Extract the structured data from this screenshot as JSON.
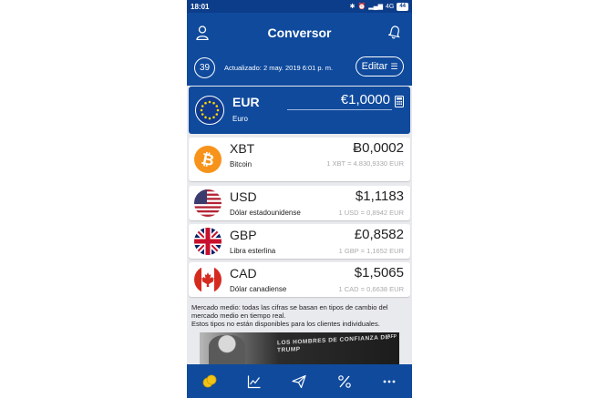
{
  "status_bar": {
    "time": "18:01",
    "network": "4G",
    "battery": "44"
  },
  "header": {
    "title": "Conversor",
    "timer": "39",
    "updated": "Actualizado: 2 may. 2019 6:01 p. m.",
    "edit_label": "Editar"
  },
  "base": {
    "code": "EUR",
    "name": "Euro",
    "amount": "€1,0000"
  },
  "currencies": [
    {
      "code": "XBT",
      "name": "Bitcoin",
      "amount": "Ƀ0,0002",
      "rate": "1 XBT = 4.830,9330 EUR"
    },
    {
      "code": "USD",
      "name": "Dólar estadounidense",
      "amount": "$1,1183",
      "rate": "1 USD = 0,8942 EUR"
    },
    {
      "code": "GBP",
      "name": "Libra esterlina",
      "amount": "£0,8582",
      "rate": "1 GBP = 1,1652 EUR"
    },
    {
      "code": "CAD",
      "name": "Dólar canadiense",
      "amount": "$1,5065",
      "rate": "1 CAD = 0,6638 EUR"
    }
  ],
  "note": {
    "line1": "Mercado medio: todas las cifras se basan en tipos de cambio del mercado medio en tiempo real.",
    "line2": "Estos tipos no están disponibles para los clientes individuales."
  },
  "ad": {
    "text": "LOS HOMBRES DE CONFIANZA DE TRUMP",
    "badge": "AFP"
  },
  "nav": [
    "converter-icon",
    "chart-icon",
    "send-icon",
    "percent-icon",
    "more-icon"
  ],
  "colors": {
    "primary": "#0f4a9d",
    "background": "#e9eaee"
  }
}
